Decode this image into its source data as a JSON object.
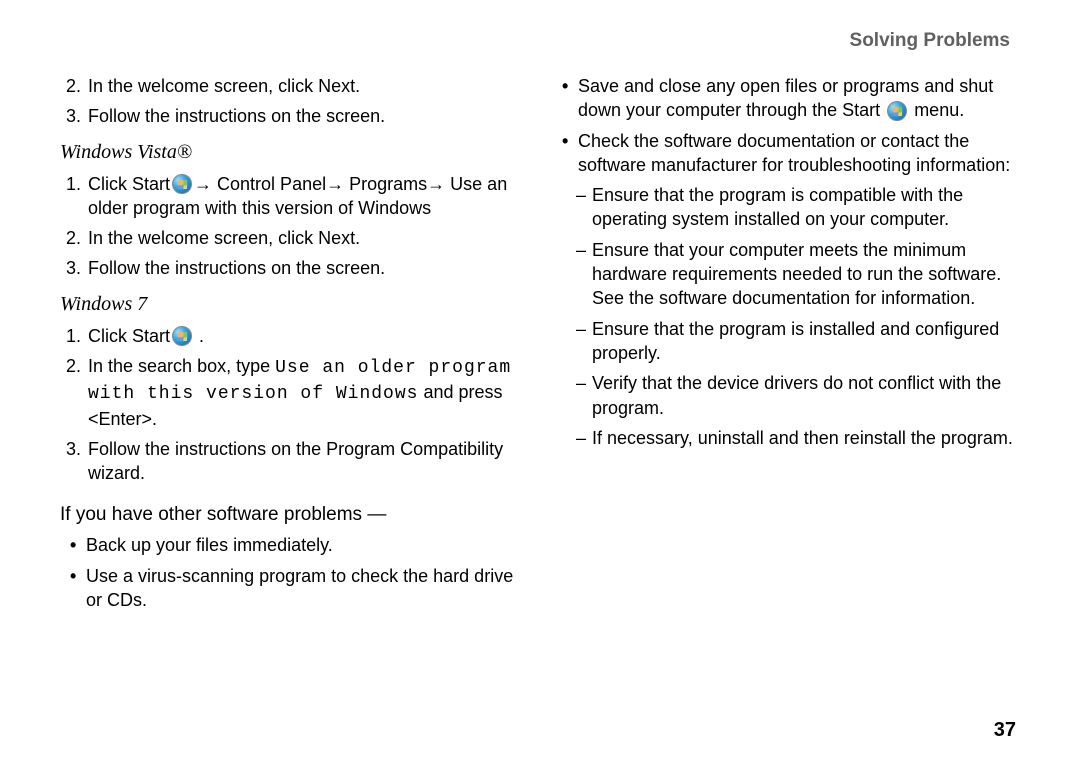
{
  "header": "Solving Problems",
  "pagenum": "37",
  "left": {
    "pre_items": [
      {
        "n": "2.",
        "text_pre": "In the welcome screen, click ",
        "text_strong": "Next",
        "text_post": "."
      },
      {
        "n": "3.",
        "text_pre": "Follow the instructions on the screen.",
        "text_strong": "",
        "text_post": ""
      }
    ],
    "vista_heading": "Windows Vista®",
    "vista_items": {
      "i1_n": "1.",
      "i1_a": "Click ",
      "i1_b": "Start",
      "i1_c": "→ ",
      "i1_d": "Control Panel",
      "i1_e": "→ ",
      "i1_f": "Programs",
      "i1_g": "→ ",
      "i1_h": "Use an older program with this version of Windows",
      "i2_n": "2.",
      "i2_a": "In the welcome screen, click ",
      "i2_b": "Next",
      "i2_c": ".",
      "i3_n": "3.",
      "i3_a": "Follow the instructions on the screen."
    },
    "win7_heading": "Windows 7",
    "win7": {
      "i1_n": "1.",
      "i1_a": "Click ",
      "i1_b": "Start",
      "i1_c": " .",
      "i2_n": "2.",
      "i2_a": "In the search box, type ",
      "i2_code": "Use an older program with this version of Windows",
      "i2_b": " and press <Enter>.",
      "i3_n": "3.",
      "i3_a": "Follow the instructions on the ",
      "i3_b": "Program Compatibility",
      "i3_c": " wizard."
    },
    "other_heading": "If you have other software problems —",
    "other_bullets": [
      "Back up your files immediately.",
      "Use a virus-scanning program to check the hard drive or CDs."
    ]
  },
  "right": {
    "b1_a": "Save and close any open files or programs and shut down your computer through the ",
    "b1_b": "Start",
    "b1_c": " menu.",
    "b2": "Check the software documentation or contact the software manufacturer for troubleshooting information:",
    "dashes": [
      "Ensure that the program is compatible with the operating system installed on your computer.",
      "Ensure that your computer meets the minimum hardware requirements needed to run the software. See the software documentation for information.",
      "Ensure that the program is installed and configured properly.",
      "Verify that the device drivers do not conflict with the program.",
      "If necessary, uninstall and then reinstall the program."
    ]
  }
}
